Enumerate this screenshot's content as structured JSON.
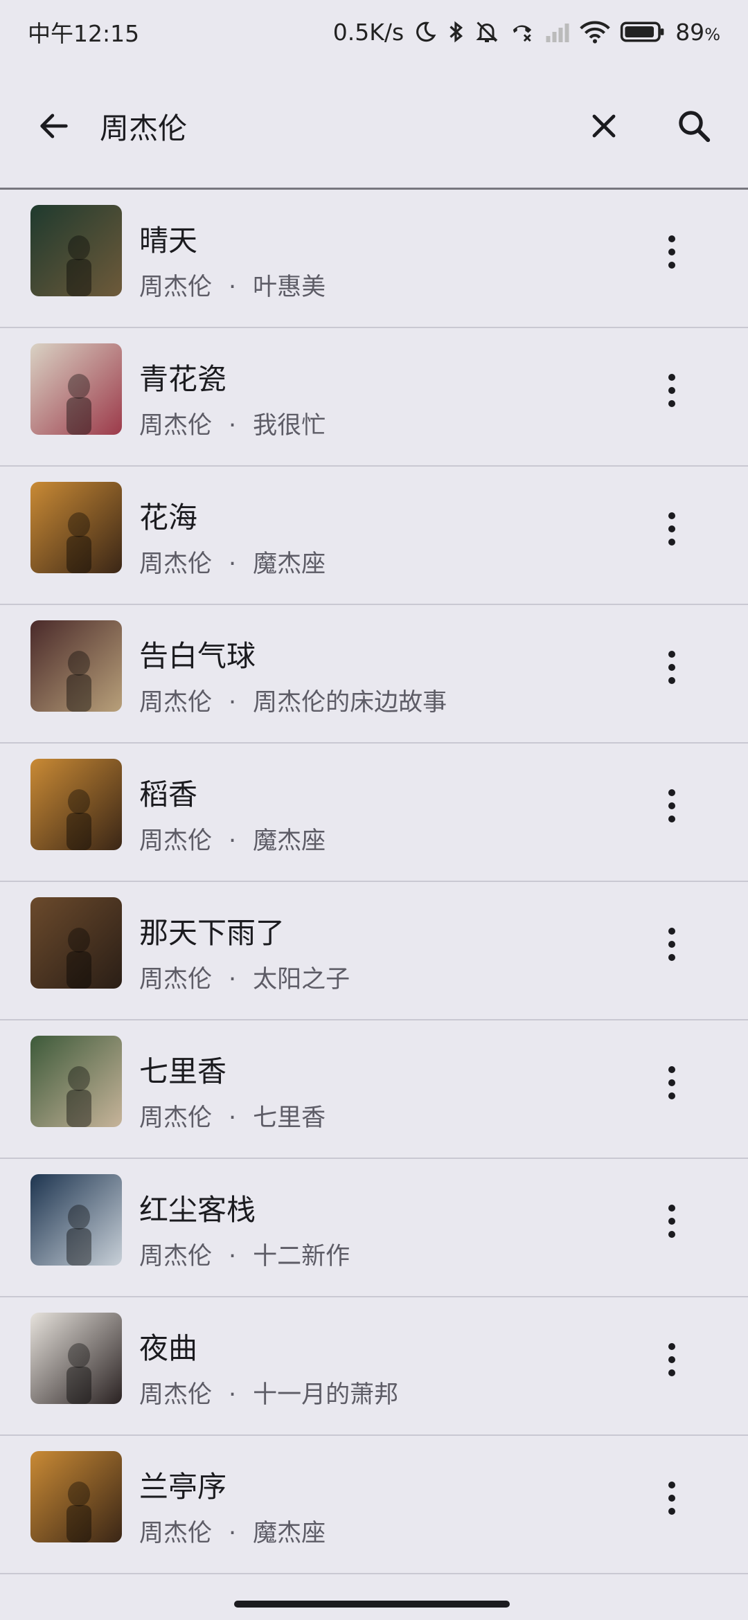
{
  "status": {
    "time": "中午12:15",
    "net_speed": "0.5K/s",
    "battery": "89",
    "battery_unit": "%"
  },
  "search": {
    "query": "周杰伦",
    "back_icon": "arrow-back-icon",
    "clear_icon": "close-icon",
    "search_icon": "search-icon"
  },
  "songs": [
    {
      "title": "晴天",
      "artist": "周杰伦",
      "sep": "·",
      "album": "叶惠美",
      "art": [
        "#1f3a2e",
        "#6e5a3a"
      ]
    },
    {
      "title": "青花瓷",
      "artist": "周杰伦",
      "sep": "·",
      "album": "我很忙",
      "art": [
        "#d9d2c4",
        "#9c3a4a"
      ]
    },
    {
      "title": "花海",
      "artist": "周杰伦",
      "sep": "·",
      "album": "魔杰座",
      "art": [
        "#c98a35",
        "#3a2616"
      ]
    },
    {
      "title": "告白气球",
      "artist": "周杰伦",
      "sep": "·",
      "album": "周杰伦的床边故事",
      "art": [
        "#4a2a2a",
        "#b8a07a"
      ]
    },
    {
      "title": "稻香",
      "artist": "周杰伦",
      "sep": "·",
      "album": "魔杰座",
      "art": [
        "#c98a35",
        "#3a2616"
      ]
    },
    {
      "title": "那天下雨了",
      "artist": "周杰伦",
      "sep": "·",
      "album": "太阳之子",
      "art": [
        "#6b4a2c",
        "#2a1e16"
      ]
    },
    {
      "title": "七里香",
      "artist": "周杰伦",
      "sep": "·",
      "album": "七里香",
      "art": [
        "#3d5a3a",
        "#c7b49a"
      ]
    },
    {
      "title": "红尘客栈",
      "artist": "周杰伦",
      "sep": "·",
      "album": "十二新作",
      "art": [
        "#1e3550",
        "#c8d0d8"
      ]
    },
    {
      "title": "夜曲",
      "artist": "周杰伦",
      "sep": "·",
      "album": "十一月的萧邦",
      "art": [
        "#e6e2dc",
        "#2a2222"
      ]
    },
    {
      "title": "兰亭序",
      "artist": "周杰伦",
      "sep": "·",
      "album": "魔杰座",
      "art": [
        "#c98a35",
        "#3a2616"
      ]
    }
  ],
  "more_icon": "more-vertical-icon"
}
